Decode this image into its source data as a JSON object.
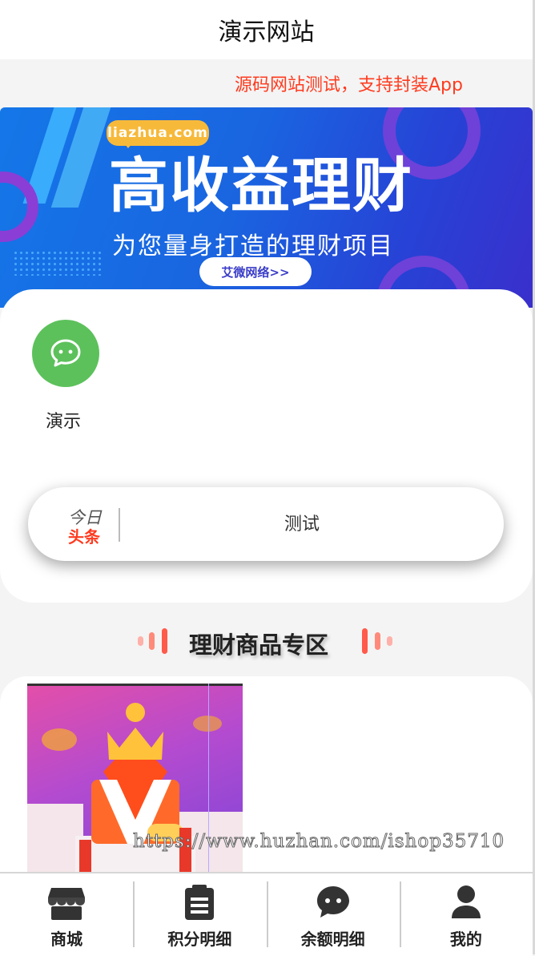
{
  "header": {
    "title": "演示网站"
  },
  "notice": {
    "text": "源码网站测试，支持封装App"
  },
  "banner": {
    "badge": "liazhua.com",
    "title": "高收益理财",
    "subtitle": "为您量身打造的理财项目",
    "button": "艾微网络>>"
  },
  "quick_entry": {
    "label": "演示",
    "icon": "wechat-chat-icon",
    "icon_color": "#5cc15b"
  },
  "news": {
    "logo_top": "今日",
    "logo_bottom": "头条",
    "text": "测试",
    "logo_color": "#ff3a1f"
  },
  "section": {
    "title": "理财商品专区",
    "accent": "#ff5a4a"
  },
  "watermark": "https://www.huzhan.com/ishop35710",
  "tabbar": {
    "items": [
      {
        "label": "商城",
        "icon": "store-icon"
      },
      {
        "label": "积分明细",
        "icon": "clipboard-icon"
      },
      {
        "label": "余额明细",
        "icon": "chat-bubble-icon"
      },
      {
        "label": "我的",
        "icon": "user-icon"
      }
    ]
  },
  "colors": {
    "accent_red": "#ff3b1f",
    "banner_blue": "#1a64e0",
    "wechat_green": "#5cc15b"
  }
}
